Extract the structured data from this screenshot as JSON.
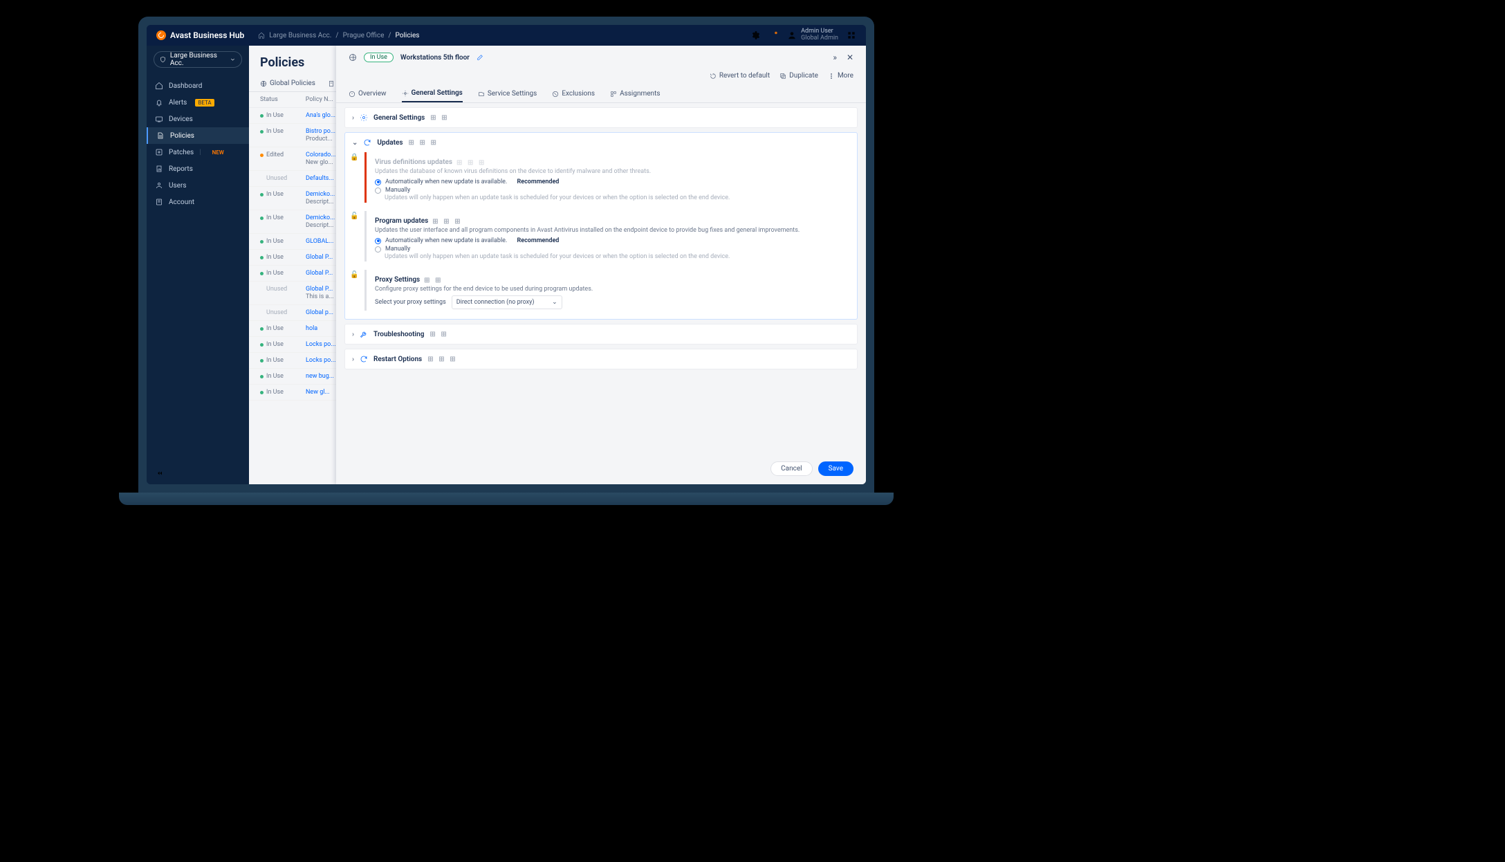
{
  "brand": "Avast Business Hub",
  "breadcrumbs": [
    "Large Business Acc.",
    "Prague Office",
    "Policies"
  ],
  "user": {
    "name": "Admin User",
    "role": "Global Admin"
  },
  "sidebar": {
    "account_label": "Large Business Acc.",
    "items": [
      {
        "label": "Dashboard"
      },
      {
        "label": "Alerts",
        "badge": "BETA"
      },
      {
        "label": "Devices"
      },
      {
        "label": "Policies",
        "active": true
      },
      {
        "label": "Patches",
        "badge": "NEW"
      },
      {
        "label": "Reports"
      },
      {
        "label": "Users"
      },
      {
        "label": "Account"
      }
    ]
  },
  "page": {
    "title": "Policies",
    "table_tab": "Global Policies",
    "columns": {
      "status": "Status",
      "name": "Policy N..."
    },
    "rows": [
      {
        "status": "In Use",
        "name": "Ana's glo..."
      },
      {
        "status": "In Use",
        "name": "Bistro po...",
        "desc": "Product..."
      },
      {
        "status": "Edited",
        "name": "Colorado...",
        "desc": "New glo..."
      },
      {
        "status": "Unused",
        "name": "Defaults..."
      },
      {
        "status": "In Use",
        "name": "Demicko...",
        "desc": "Descript..."
      },
      {
        "status": "In Use",
        "name": "Demicko...",
        "desc": "Descript..."
      },
      {
        "status": "In Use",
        "name": "GLOBAL..."
      },
      {
        "status": "In Use",
        "name": "Global P..."
      },
      {
        "status": "In Use",
        "name": "Global P..."
      },
      {
        "status": "Unused",
        "name": "Global P...",
        "desc": "This is a..."
      },
      {
        "status": "Unused",
        "name": "Global p..."
      },
      {
        "status": "In Use",
        "name": "hola"
      },
      {
        "status": "In Use",
        "name": "Locks po..."
      },
      {
        "status": "In Use",
        "name": "Locks po..."
      },
      {
        "status": "In Use",
        "name": "new bug..."
      },
      {
        "status": "In Use",
        "name": "New gl..."
      }
    ]
  },
  "drawer": {
    "status_pill": "In Use",
    "title": "Workstations 5th floor",
    "actions": {
      "revert": "Revert to default",
      "duplicate": "Duplicate",
      "more": "More"
    },
    "tabs": [
      "Overview",
      "General Settings",
      "Service Settings",
      "Exclusions",
      "Assignments"
    ],
    "active_tab": 1,
    "sections": {
      "general": "General Settings",
      "updates": {
        "title": "Updates",
        "virus": {
          "title": "Virus definitions updates",
          "desc": "Updates the database of known virus definitions on the device to identify malware and other threats.",
          "opt_auto": "Automatically when new update is available.",
          "rec": "Recommended",
          "opt_manual": "Manually",
          "manual_hint": "Updates will only happen when an update task is scheduled for your devices or when the option is selected on the end device."
        },
        "program": {
          "title": "Program updates",
          "desc": "Updates the user interface and all program components in Avast Antivirus installed on the endpoint device to provide bug fixes and general improvements.",
          "opt_auto": "Automatically when new update is available.",
          "rec": "Recommended",
          "opt_manual": "Manually",
          "manual_hint": "Updates will only happen when an update task is scheduled for your devices or when the option is selected on the end device."
        },
        "proxy": {
          "title": "Proxy Settings",
          "desc": "Configure proxy settings for the end device to be used during program updates.",
          "label": "Select your proxy settings",
          "value": "Direct connection (no proxy)"
        }
      },
      "troubleshooting": "Troubleshooting",
      "restart": "Restart Options"
    },
    "footer": {
      "cancel": "Cancel",
      "save": "Save"
    }
  }
}
